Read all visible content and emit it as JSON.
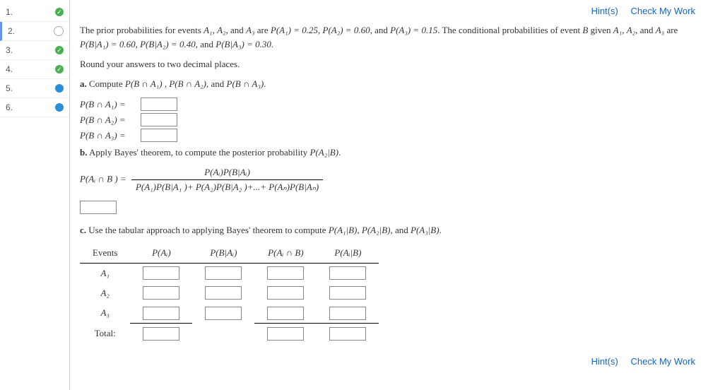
{
  "nav": [
    {
      "num": "1.",
      "status": "done"
    },
    {
      "num": "2.",
      "status": "open",
      "current": true
    },
    {
      "num": "3.",
      "status": "done"
    },
    {
      "num": "4.",
      "status": "done"
    },
    {
      "num": "5.",
      "status": "blue"
    },
    {
      "num": "6.",
      "status": "blue"
    }
  ],
  "toolbar": {
    "hints": "Hint(s)",
    "check": "Check My Work"
  },
  "intro": {
    "line1_a": "The prior probabilities for events ",
    "A1": "A₁",
    "A2": "A₂",
    "A3": "A₃",
    "line1_b": " are ",
    "PA1": "P(A₁) = 0.25",
    "PA2": "P(A₂) = 0.60",
    "PA3": "P(A₃) = 0.15",
    "line1_c": ". The conditional probabilities of event ",
    "B": "B",
    "line1_d": " given ",
    "line2_a": " are ",
    "PBA1": "P(B|A₁) = 0.60",
    "PBA2": "P(B|A₂) = 0.40",
    "PBA3": "P(B|A₃) = 0.30",
    "round": "Round your answers to two decimal places."
  },
  "partA": {
    "label": "a.",
    "text1": " Compute ",
    "q1": "P(B ∩ A₁)",
    "q2": "P(B ∩ A₂)",
    "q3": "P(B ∩ A₃)",
    "and": ", and ",
    "rows": {
      "r1": "P(B ∩ A₁) =",
      "r2": "P(B ∩ A₂) =",
      "r3": "P(B ∩ A₃) ="
    }
  },
  "partB": {
    "label": "b.",
    "text": " Apply Bayes' theorem, to compute the posterior probability ",
    "target": "P(A₂|B)",
    "lhs": "P(Aᵢ ∩ B ) = ",
    "num": "P(Aᵢ)P(B|Aᵢ)",
    "den": "P(A₁)P(B|A₁ )+ P(A₂)P(B|A₂ )+...+ P(Aₙ)P(B|Aₙ)"
  },
  "partC": {
    "label": "c.",
    "text": " Use the tabular approach to applying Bayes' theorem to compute ",
    "q1": "P(A₁|B)",
    "q2": "P(A₂|B)",
    "q3": "P(A₃|B)",
    "and": ", and ",
    "headers": {
      "events": "Events",
      "pAi": "P(Aᵢ)",
      "pBAi": "P(B|Aᵢ)",
      "pAiB_int": "P(Aᵢ ∩ B)",
      "pAiB_cond": "P(Aᵢ|B)"
    },
    "rows": {
      "A1": "A₁",
      "A2": "A₂",
      "A3": "A₃",
      "total": "Total:"
    }
  }
}
